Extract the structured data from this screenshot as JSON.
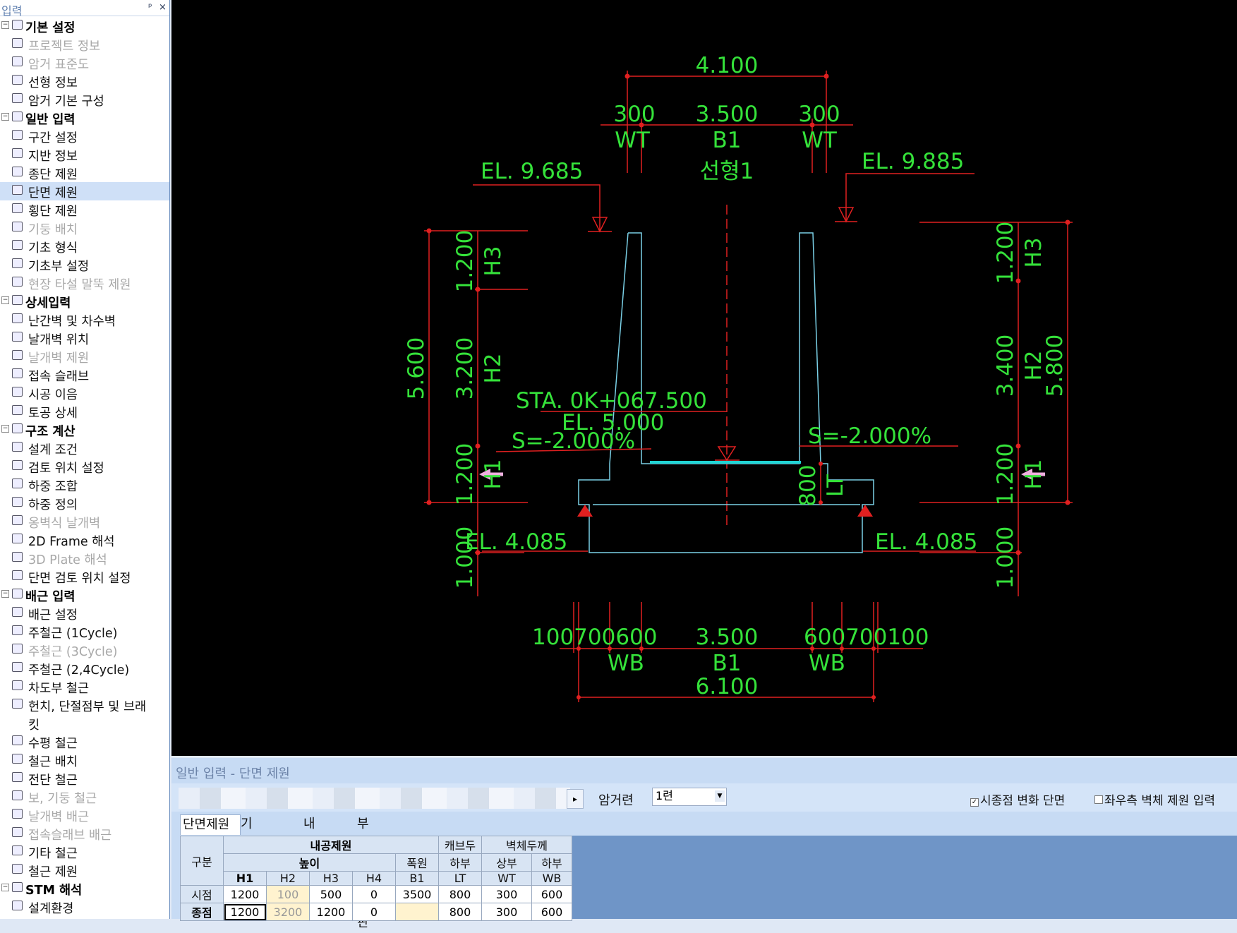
{
  "left_panel": {
    "title": "입력",
    "pin": "ᵖ",
    "close": "×",
    "tree": [
      {
        "type": "cat",
        "label": "기본 설정"
      },
      {
        "type": "item",
        "label": "프로젝트 정보",
        "disabled": true
      },
      {
        "type": "item",
        "label": "암거 표준도",
        "disabled": true
      },
      {
        "type": "item",
        "label": "선형 정보"
      },
      {
        "type": "item",
        "label": "암거 기본 구성"
      },
      {
        "type": "cat",
        "label": "일반 입력"
      },
      {
        "type": "item",
        "label": "구간 설정"
      },
      {
        "type": "item",
        "label": "지반 정보"
      },
      {
        "type": "item",
        "label": "종단 제원"
      },
      {
        "type": "item",
        "label": "단면 제원",
        "selected": true
      },
      {
        "type": "item",
        "label": "횡단 제원"
      },
      {
        "type": "item",
        "label": "기둥 배치",
        "disabled": true
      },
      {
        "type": "item",
        "label": "기초 형식"
      },
      {
        "type": "item",
        "label": "기초부 설정"
      },
      {
        "type": "item",
        "label": "현장 타설 말뚝 제원",
        "disabled": true
      },
      {
        "type": "cat",
        "label": "상세입력"
      },
      {
        "type": "item",
        "label": "난간벽 및 차수벽"
      },
      {
        "type": "item",
        "label": "날개벽 위치"
      },
      {
        "type": "item",
        "label": "날개벽 제원",
        "disabled": true
      },
      {
        "type": "item",
        "label": "접속 슬래브"
      },
      {
        "type": "item",
        "label": "시공 이음"
      },
      {
        "type": "item",
        "label": "토공 상세"
      },
      {
        "type": "cat",
        "label": "구조 계산"
      },
      {
        "type": "item",
        "label": "설계 조건"
      },
      {
        "type": "item",
        "label": "검토 위치 설정"
      },
      {
        "type": "item",
        "label": "하중 조합"
      },
      {
        "type": "item",
        "label": "하중 정의"
      },
      {
        "type": "item",
        "label": "옹벽식 날개벽",
        "disabled": true
      },
      {
        "type": "item",
        "label": "2D Frame 해석"
      },
      {
        "type": "item",
        "label": "3D Plate 해석",
        "disabled": true
      },
      {
        "type": "item",
        "label": "단면 검토 위치 설정"
      },
      {
        "type": "cat",
        "label": "배근 입력"
      },
      {
        "type": "item",
        "label": "배근 설정"
      },
      {
        "type": "item",
        "label": "주철근 (1Cycle)"
      },
      {
        "type": "item",
        "label": "주철근 (3Cycle)",
        "disabled": true
      },
      {
        "type": "item",
        "label": "주철근 (2,4Cycle)"
      },
      {
        "type": "item",
        "label": "차도부 철근"
      },
      {
        "type": "item",
        "label": "헌치, 단절점부 및 브래",
        "extra": "킷"
      },
      {
        "type": "item",
        "label": "수평 철근"
      },
      {
        "type": "item",
        "label": "철근 배치"
      },
      {
        "type": "item",
        "label": "전단 철근"
      },
      {
        "type": "item",
        "label": "보, 기둥 철근",
        "disabled": true
      },
      {
        "type": "item",
        "label": "날개벽 배근",
        "disabled": true
      },
      {
        "type": "item",
        "label": "접속슬래브 배근",
        "disabled": true
      },
      {
        "type": "item",
        "label": "기타 철근"
      },
      {
        "type": "item",
        "label": "철근 제원"
      },
      {
        "type": "cat",
        "label": "STM 해석"
      },
      {
        "type": "item",
        "label": "설계환경"
      }
    ]
  },
  "drawing": {
    "texts": {
      "top_total": "4.100",
      "top_l": "300",
      "top_c": "3.500",
      "top_r": "300",
      "wt_l": "WT",
      "b1_top": "B1",
      "wt_r": "WT",
      "el_left_top": "EL. 9.685",
      "el_right_top": "EL. 9.885",
      "alignment": "선형1",
      "h3_l_val": "1.200",
      "h3_l": "H3",
      "h2_l_val": "3.200",
      "h2_l": "H2",
      "h1_l_val": "1.200",
      "h1_l": "H1",
      "total_l": "5.600",
      "base_l": "1.000",
      "h3_r_val": "1.200",
      "h3_r": "H3",
      "h2_r_val": "3.400",
      "h2_r": "H2",
      "total_r": "5.800",
      "h1_r_val": "1.200",
      "h1_r": "H1",
      "base_r": "1.000",
      "sta": "STA. 0K+067.500",
      "el_center": "EL. 5.000",
      "slope_l": "S=-2.000%",
      "slope_r": "S=-2.000%",
      "lt_val": "800",
      "lt": "LT",
      "el_bot_l": "EL. 4.085",
      "el_bot_r": "EL. 4.085",
      "bot_l": "100700600",
      "bot_c": "3.500",
      "bot_r": "600700100",
      "wb_l": "WB",
      "b1_bot": "B1",
      "wb_r": "WB",
      "bot_total": "6.100"
    }
  },
  "bottom_panel": {
    "title": "일반 입력 - 단면 제원",
    "nav_arrow": "▸",
    "bridge_label": "암거련",
    "bridge_value": "1련",
    "check1": {
      "label": "시종점 변화 단면",
      "checked": true
    },
    "check2": {
      "label": "좌우측 벽체 제원 입력",
      "checked": false
    },
    "tabs": [
      "단면제원",
      "기타제원",
      "내부헌치",
      "부상방지저판"
    ],
    "table": {
      "h_gubun": "구분",
      "h_inner": "내공제원",
      "h_slab": "캐브두",
      "h_wall": "벽체두께",
      "h_height": "높이",
      "h_width": "폭원",
      "h_bottom": "하부",
      "h_wall_top": "상부",
      "h_wall_bot": "하부",
      "cols": [
        "H1",
        "H2",
        "H3",
        "H4",
        "B1",
        "LT",
        "WT",
        "WB"
      ],
      "rows": [
        {
          "name": "시점",
          "values": [
            "1200",
            "100",
            "500",
            "0",
            "3500",
            "800",
            "300",
            "600"
          ]
        },
        {
          "name": "종점",
          "values": [
            "1200",
            "3200",
            "1200",
            "0",
            "",
            "800",
            "300",
            "600"
          ]
        }
      ]
    }
  }
}
